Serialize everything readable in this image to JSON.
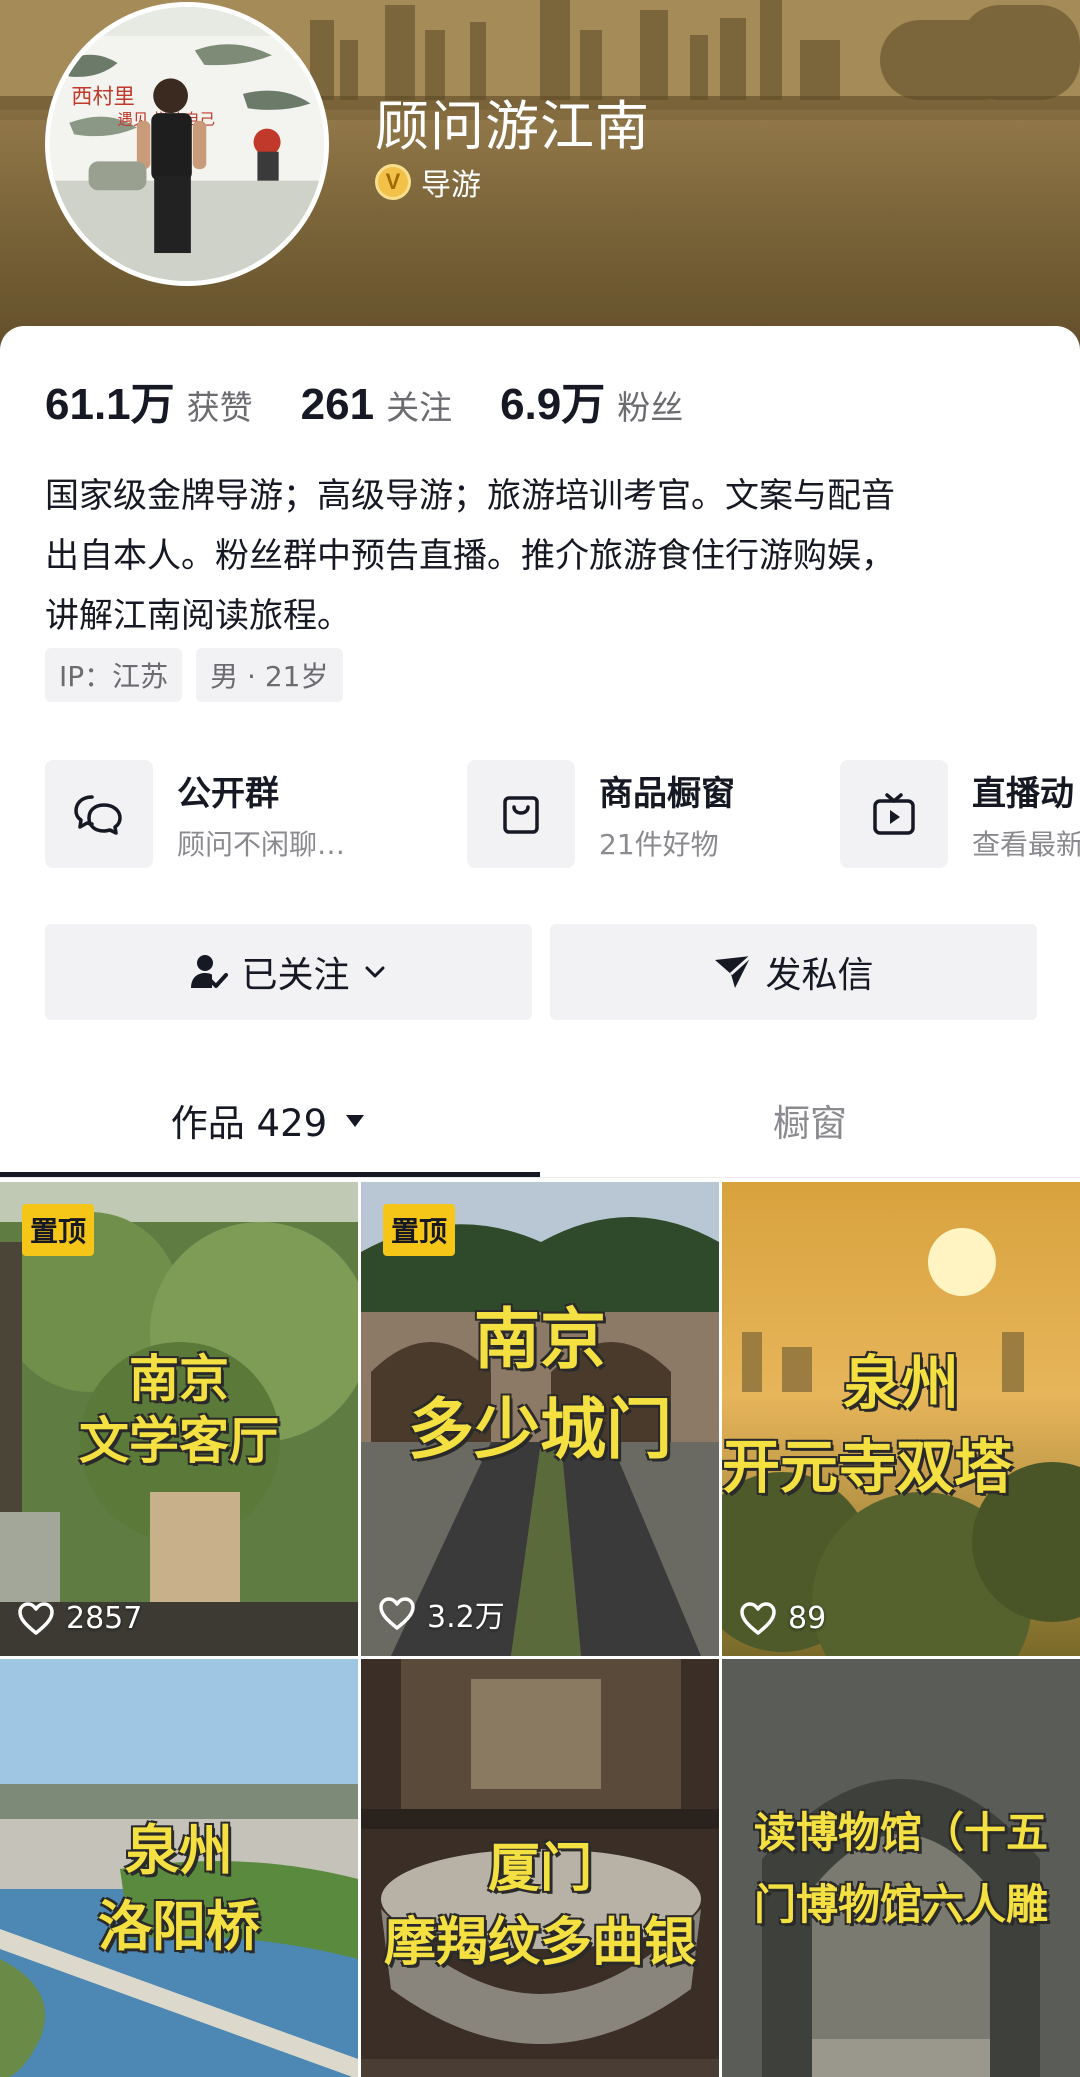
{
  "profile": {
    "username": "顾问游江南",
    "verified_label": "导游",
    "avatar_sign_text_1": "西村里",
    "avatar_sign_text_2": "遇见   样的自己"
  },
  "stats": [
    {
      "value": "61.1万",
      "label": "获赞"
    },
    {
      "value": "261",
      "label": "关注"
    },
    {
      "value": "6.9万",
      "label": "粉丝"
    }
  ],
  "bio": {
    "line1": "国家级金牌导游；高级导游；旅游培训考官。文案与配音",
    "line2": "出自本人。粉丝群中预告直播。推介旅游食住行游购娱，",
    "line3": "讲解江南阅读旅程。"
  },
  "tags": [
    "IP：江苏",
    "男 · 21岁"
  ],
  "quick_links": [
    {
      "title": "公开群",
      "subtitle": "顾问不闲聊…",
      "icon": "group-chat-icon"
    },
    {
      "title": "商品橱窗",
      "subtitle": "21件好物",
      "icon": "shopping-bag-icon"
    },
    {
      "title": "直播动",
      "subtitle": "查看最新",
      "icon": "tv-play-icon"
    }
  ],
  "actions": {
    "follow_label": "已关注",
    "message_label": "发私信"
  },
  "tabs": {
    "works_label": "作品 429",
    "shop_label": "橱窗"
  },
  "videos": [
    {
      "pinned": true,
      "pin_label": "置顶",
      "title_line1": "南京",
      "title_line2": "文学客厅",
      "likes": "2857"
    },
    {
      "pinned": true,
      "pin_label": "置顶",
      "title_line1": "南京",
      "title_line2": "多少城门",
      "likes": "3.2万"
    },
    {
      "pinned": false,
      "pin_label": "",
      "title_line1": "泉州",
      "title_line2": "开元寺双塔",
      "likes": "89"
    },
    {
      "pinned": false,
      "pin_label": "",
      "title_line1": "泉州",
      "title_line2": "洛阳桥",
      "likes": ""
    },
    {
      "pinned": false,
      "pin_label": "",
      "title_line1": "厦门",
      "title_line2": "摩羯纹多曲银",
      "likes": ""
    },
    {
      "pinned": false,
      "pin_label": "",
      "title_line1": "读博物馆（十五",
      "title_line2": "门博物馆六人雕",
      "likes": ""
    }
  ],
  "colors": {
    "pin_bg": "#f5c518",
    "title_yellow": "#f5e042",
    "banner_brown": "#8a7243"
  }
}
